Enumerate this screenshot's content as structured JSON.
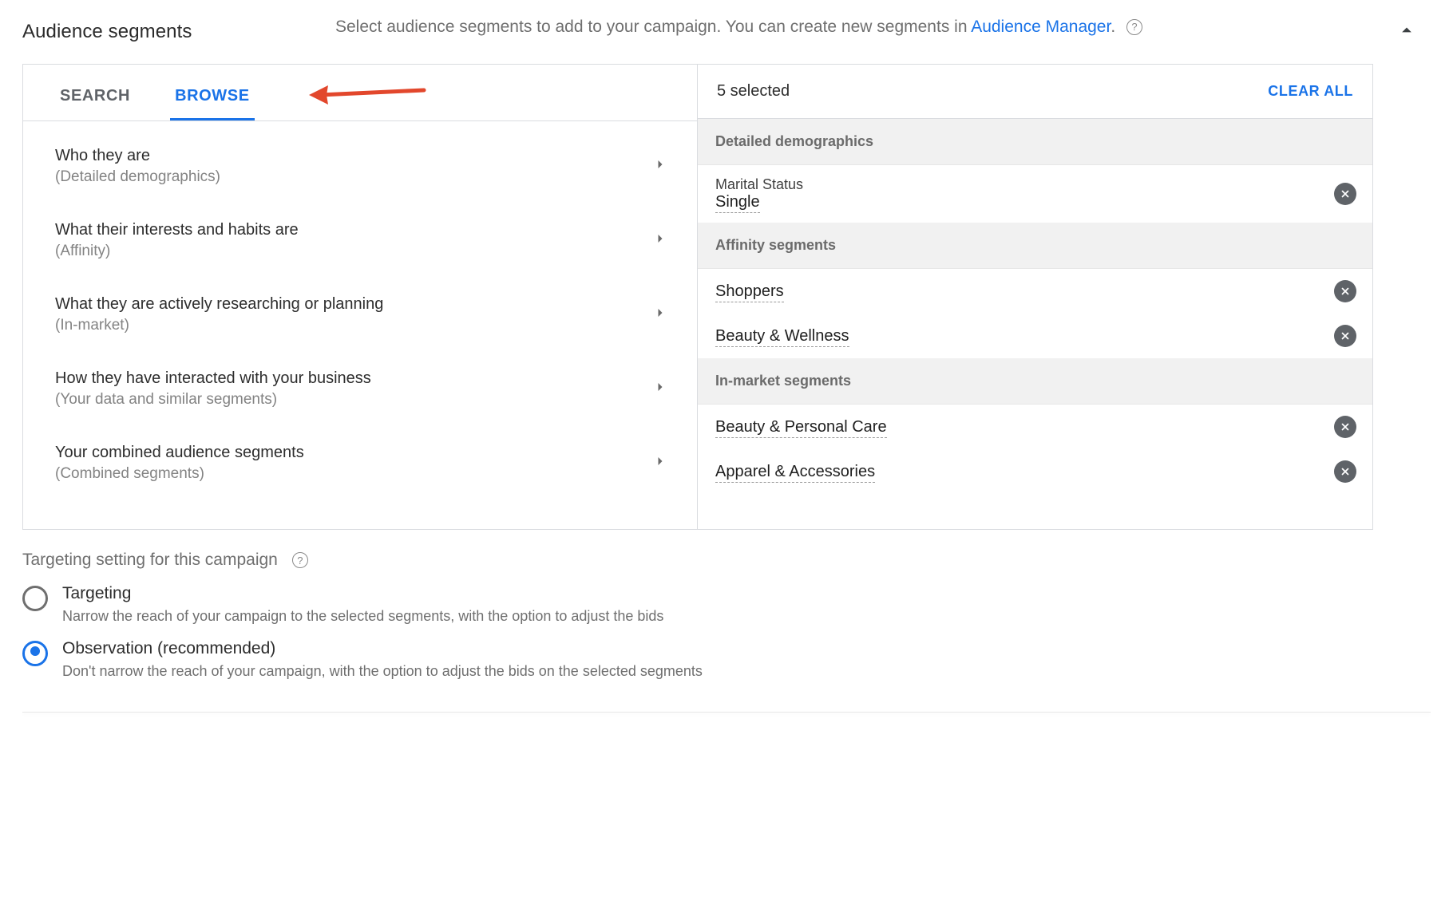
{
  "header": {
    "title": "Audience segments",
    "intro_prefix": "Select audience segments to add to your campaign. You can create new segments in ",
    "intro_link": "Audience Manager",
    "intro_suffix": "."
  },
  "tabs": {
    "search": "SEARCH",
    "browse": "BROWSE"
  },
  "browse_items": [
    {
      "title": "Who they are",
      "sub": "(Detailed demographics)"
    },
    {
      "title": "What their interests and habits are",
      "sub": "(Affinity)"
    },
    {
      "title": "What they are actively researching or planning",
      "sub": "(In-market)"
    },
    {
      "title": "How they have interacted with your business",
      "sub": "(Your data and similar segments)"
    },
    {
      "title": "Your combined audience segments",
      "sub": "(Combined segments)"
    }
  ],
  "selected": {
    "count_text": "5 selected",
    "clear": "CLEAR ALL",
    "sections": [
      {
        "header": "Detailed demographics",
        "chips": [
          {
            "label": "Marital Status",
            "value": "Single"
          }
        ]
      },
      {
        "header": "Affinity segments",
        "chips": [
          {
            "value": "Shoppers"
          },
          {
            "value": "Beauty & Wellness"
          }
        ]
      },
      {
        "header": "In-market segments",
        "chips": [
          {
            "value": "Beauty & Personal Care"
          },
          {
            "value": "Apparel & Accessories"
          }
        ]
      }
    ]
  },
  "targeting": {
    "heading": "Targeting setting for this campaign",
    "options": {
      "targeting": {
        "label": "Targeting",
        "desc": "Narrow the reach of your campaign to the selected segments, with the option to adjust the bids"
      },
      "observation": {
        "label": "Observation (recommended)",
        "desc": "Don't narrow the reach of your campaign, with the option to adjust the bids on the selected segments"
      }
    },
    "selected": "observation"
  }
}
